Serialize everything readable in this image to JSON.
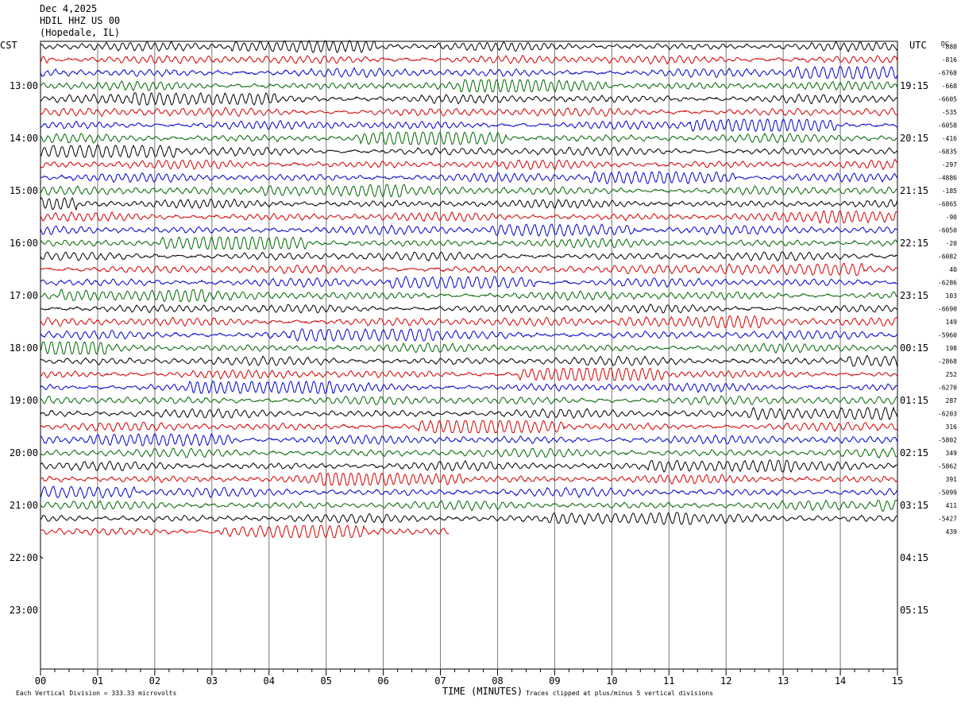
{
  "header": {
    "date": "Dec 4,2025",
    "station": "HDIL HHZ US 00",
    "location": "(Hopedale, IL)"
  },
  "chart_data": {
    "type": "line",
    "title": "Dec 4,2025  HDIL HHZ US 00  (Hopedale, IL)",
    "xlabel": "TIME (MINUTES)",
    "left_axis_label": "CST",
    "right_axis_label": "UTC",
    "dc_label": "DC",
    "x_ticks": [
      "00",
      "01",
      "02",
      "03",
      "04",
      "05",
      "06",
      "07",
      "08",
      "09",
      "10",
      "11",
      "12",
      "13",
      "14",
      "15"
    ],
    "xlim": [
      0,
      15
    ],
    "cst_ticks": [
      "13:00",
      "14:00",
      "15:00",
      "16:00",
      "17:00",
      "18:00",
      "19:00",
      "20:00",
      "21:00",
      "22:00",
      "23:00"
    ],
    "utc_ticks": [
      "19:15",
      "20:15",
      "21:15",
      "22:15",
      "23:15",
      "00:15",
      "01:15",
      "02:15",
      "03:15",
      "04:15",
      "05:15"
    ],
    "first_trace_hour_offset": 0.25,
    "trace_colors": [
      "#000000",
      "#d40000",
      "#0000cc",
      "#006600"
    ],
    "trace_count": 38,
    "last_trace_minutes": 7.15,
    "dc_offsets": [
      "-888",
      "-816",
      "-6768",
      "-668",
      "-6605",
      "-535",
      "-6058",
      "-416",
      "-6835",
      "-297",
      "-4886",
      "-185",
      "-6865",
      "-90",
      "-6050",
      "-20",
      "-6082",
      "40",
      "-6286",
      "103",
      "-6690",
      "149",
      "-5960",
      "198",
      "-2868",
      "252",
      "-6270",
      "287",
      "-6203",
      "316",
      "-5802",
      "349",
      "-5862",
      "391",
      "-5099",
      "411",
      "-5427",
      "439"
    ],
    "footnote_left": "Each Vertical Division =  333.33 microvolts",
    "footnote_right": "Traces clipped at plus/minus 5 vertical divisions"
  }
}
